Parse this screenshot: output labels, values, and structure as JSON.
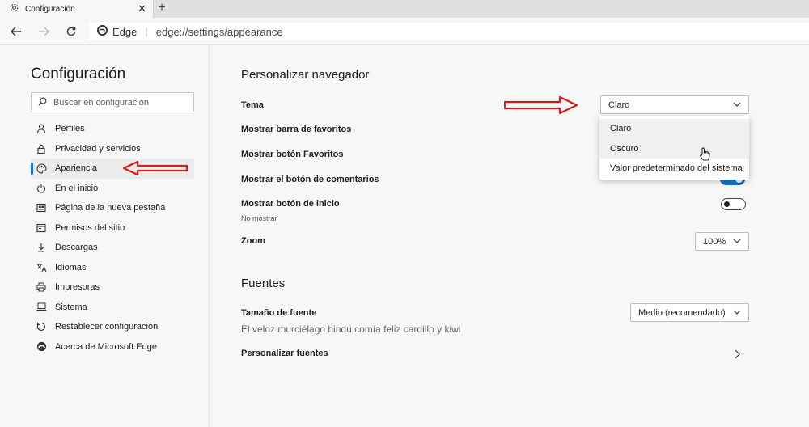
{
  "browser": {
    "tab_title": "Configuración",
    "tab_close": "✕",
    "new_tab": "+",
    "address": {
      "site_label": "Edge",
      "separator": "|",
      "url": "edge://settings/appearance"
    }
  },
  "sidebar": {
    "title": "Configuración",
    "search_placeholder": "Buscar en configuración",
    "items": [
      {
        "label": "Perfiles",
        "icon": "person-icon"
      },
      {
        "label": "Privacidad y servicios",
        "icon": "lock-icon"
      },
      {
        "label": "Apariencia",
        "icon": "palette-icon",
        "active": true
      },
      {
        "label": "En el inicio",
        "icon": "power-icon"
      },
      {
        "label": "Página de la nueva pestaña",
        "icon": "new-tab-page-icon"
      },
      {
        "label": "Permisos del sitio",
        "icon": "site-permissions-icon"
      },
      {
        "label": "Descargas",
        "icon": "download-icon"
      },
      {
        "label": "Idiomas",
        "icon": "language-icon"
      },
      {
        "label": "Impresoras",
        "icon": "printer-icon"
      },
      {
        "label": "Sistema",
        "icon": "laptop-icon"
      },
      {
        "label": "Restablecer configuración",
        "icon": "reset-icon"
      },
      {
        "label": "Acerca de Microsoft Edge",
        "icon": "edge-logo-icon"
      }
    ]
  },
  "main": {
    "customize": {
      "title": "Personalizar navegador",
      "theme_label": "Tema",
      "theme_value": "Claro",
      "theme_options": [
        "Claro",
        "Oscuro",
        "Valor predeterminado del sistema"
      ],
      "favorites_bar_label": "Mostrar barra de favoritos",
      "favorites_button_label": "Mostrar botón Favoritos",
      "feedback_button_label": "Mostrar el botón de comentarios",
      "feedback_button_on": true,
      "home_button_label": "Mostrar botón de inicio",
      "home_button_sub": "No mostrar",
      "home_button_on": false,
      "zoom_label": "Zoom",
      "zoom_value": "100%"
    },
    "fonts": {
      "title": "Fuentes",
      "size_label": "Tamaño de fuente",
      "size_value": "Medio (recomendado)",
      "sample_text": "El veloz murciélago hindú comía feliz cardillo y kiwi",
      "customize_label": "Personalizar fuentes"
    }
  },
  "colors": {
    "accent": "#1a73c8",
    "annotation_red": "#d01e1e"
  }
}
